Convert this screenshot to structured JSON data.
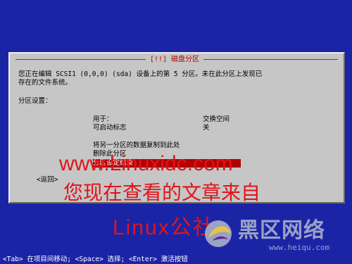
{
  "dialog": {
    "title": "[!!] 磁盘分区",
    "description_line1": "您正在编辑 SCSI1 (0,0,0) (sda) 设备上的第 5 分区。未在此分区上发现已",
    "description_line2": "存在的文件系统。",
    "section_label": "分区设置：",
    "settings": [
      {
        "label": "用于：",
        "value": "交换空间"
      },
      {
        "label": "可启动标志",
        "value": "关"
      }
    ],
    "actions": [
      "将另一分区的数据复制到此处",
      "删除此分区",
      "分区设定结束"
    ],
    "back_label": "<返回>"
  },
  "watermark": {
    "site": "www.Linuxidc.com",
    "line2": "您现在查看的文章来自",
    "line3": "Linux公社"
  },
  "footer": {
    "hint": "<Tab> 在项目间移动; <Space> 选择; <Enter> 激活按钮"
  },
  "logo": {
    "name": "黑区网络",
    "url": "www.heiqu.com"
  },
  "colors": {
    "background": "#1c24a6",
    "dialog": "#c6c6c6",
    "accent": "#b00000",
    "watermark": "#e0141a"
  }
}
